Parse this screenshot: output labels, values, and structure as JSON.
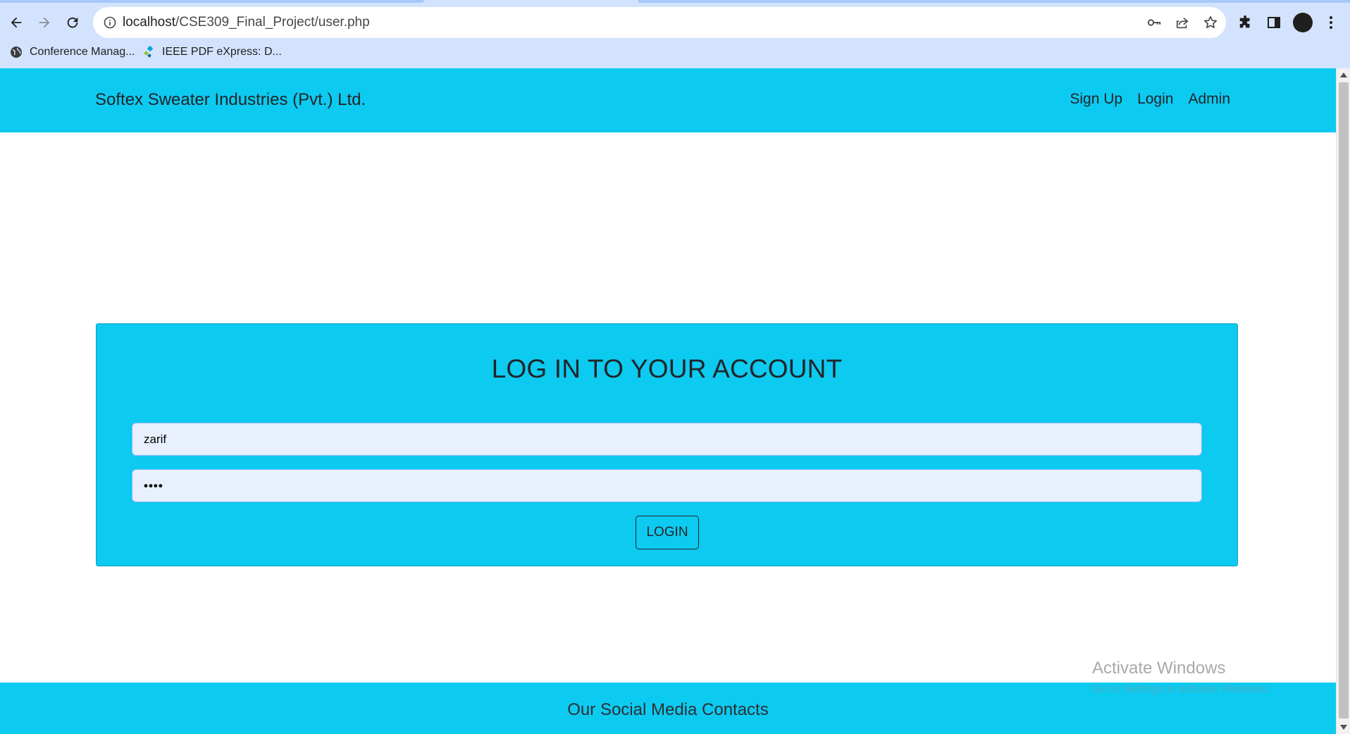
{
  "browser": {
    "url_host": "localhost",
    "url_path": "/CSE309_Final_Project/user.php",
    "bookmarks": [
      {
        "label": "Conference Manag...",
        "icon": "globe-icon"
      },
      {
        "label": "IEEE PDF eXpress: D...",
        "icon": "ieee-icon"
      }
    ]
  },
  "site": {
    "brand": "Softex Sweater Industries (Pvt.) Ltd.",
    "nav": [
      {
        "label": "Sign Up"
      },
      {
        "label": "Login"
      },
      {
        "label": "Admin"
      }
    ],
    "accent_color": "#0dcaf0"
  },
  "login": {
    "title": "LOG IN TO YOUR ACCOUNT",
    "username_value": "zarif",
    "password_value": "••••",
    "button_label": "LOGIN"
  },
  "footer": {
    "title": "Our Social Media Contacts"
  },
  "watermark": {
    "title": "Activate Windows",
    "subtitle": "Go to Settings to activate Windows."
  }
}
